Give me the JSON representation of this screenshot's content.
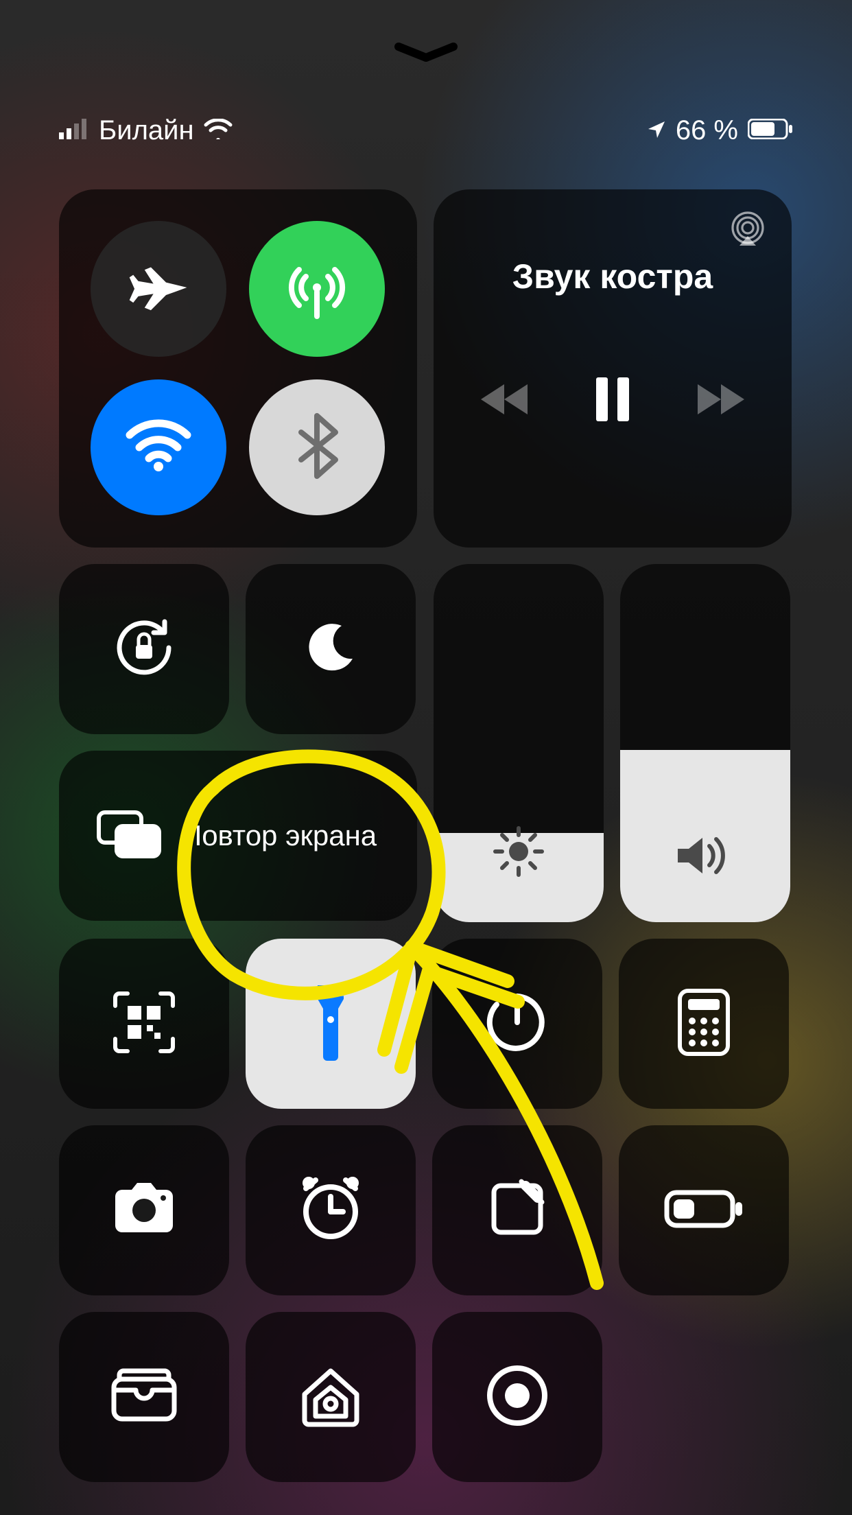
{
  "status": {
    "carrier": "Билайн",
    "battery_text": "66 %"
  },
  "media": {
    "title": "Звук костра"
  },
  "screen_mirroring": {
    "label": "Повтор экрана"
  },
  "sliders": {
    "brightness_percent": 25,
    "volume_percent": 48
  },
  "toggles": {
    "airplane": false,
    "cellular": true,
    "wifi": true,
    "bluetooth": true,
    "orientation_lock": false,
    "do_not_disturb": false,
    "flashlight": true
  },
  "colors": {
    "active_green": "#32d159",
    "active_blue": "#007aff",
    "tile_dark": "rgba(0,0,0,0.62)",
    "annotation": "#f5e400"
  }
}
